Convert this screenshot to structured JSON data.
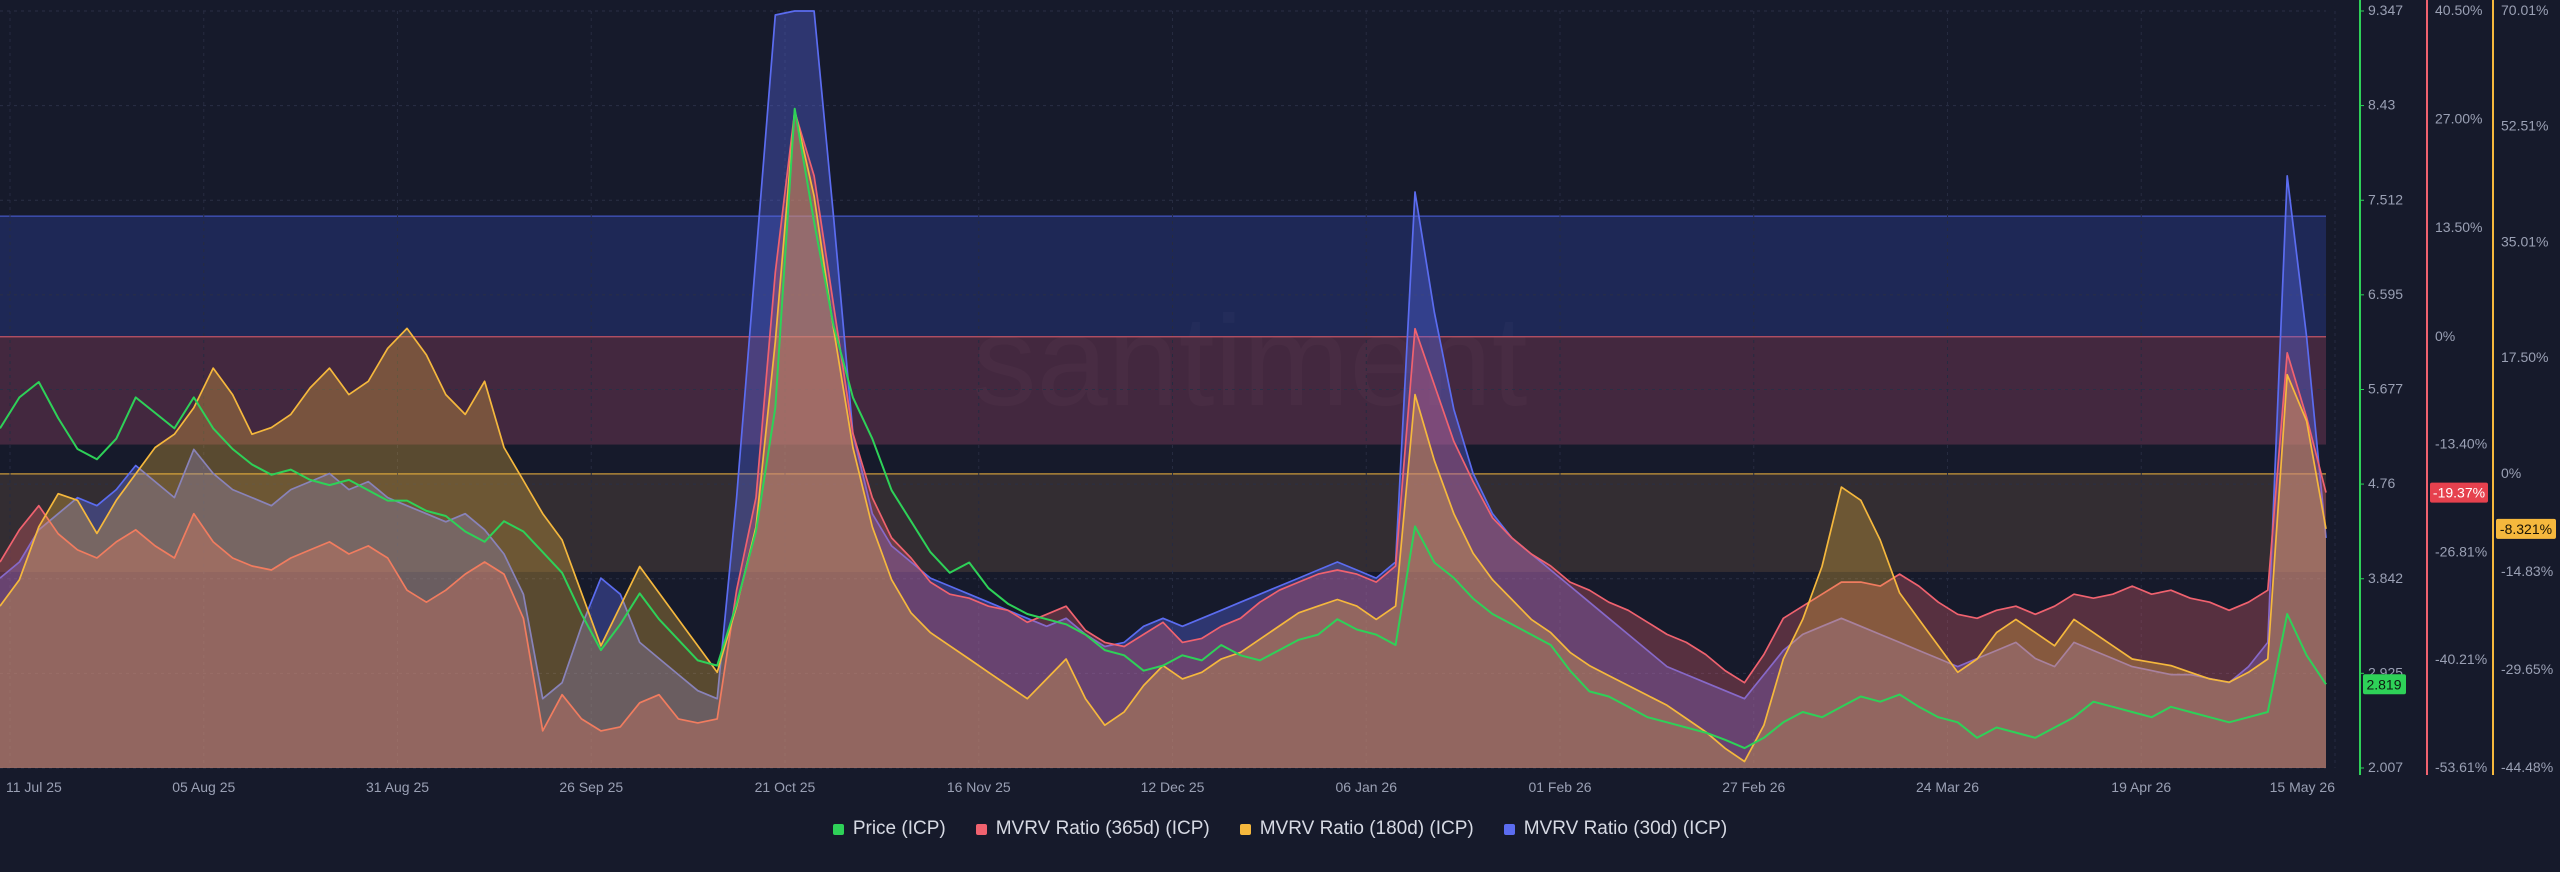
{
  "colors": {
    "background": "#161a2b",
    "price": "#2ed158",
    "mvrv365": "#f0626f",
    "mvrv180": "#f5b83d",
    "mvrv30": "#5b6cf0",
    "price_tag_bg": "#2ed158",
    "mvrv365_tag_bg": "#e6414e",
    "mvrv180_tag_bg": "#f5b83d"
  },
  "watermark": "santiment",
  "chart_data": {
    "type": "line",
    "x_tick_labels": [
      "11 Jul 25",
      "05 Aug 25",
      "31 Aug 25",
      "26 Sep 25",
      "21 Oct 25",
      "16 Nov 25",
      "12 Dec 25",
      "06 Jan 26",
      "01 Feb 26",
      "27 Feb 26",
      "24 Mar 26",
      "19 Apr 26",
      "15 May 26"
    ],
    "x_range": [
      "2025-07-11",
      "2026-05-15"
    ],
    "axes": {
      "price": {
        "ticks": [
          "9.347",
          "8.43",
          "7.512",
          "6.595",
          "5.677",
          "4.76",
          "3.842",
          "2.925",
          "2.007"
        ],
        "range": [
          2.007,
          9.347
        ],
        "current_value": "2.819"
      },
      "mvrv365": {
        "ticks": [
          "40.50%",
          "27.00%",
          "13.50%",
          "0%",
          "-13.40%",
          "-26.81%",
          "-40.21%",
          "-53.61%"
        ],
        "range": [
          -53.61,
          40.5
        ],
        "current_value": "-19.37%"
      },
      "mvrv180": {
        "ticks": [
          "70.01%",
          "52.51%",
          "35.01%",
          "17.50%",
          "0%",
          "-14.83%",
          "-29.65%",
          "-44.48%"
        ],
        "range": [
          -44.48,
          70.01
        ],
        "current_value": "-8.321%"
      }
    },
    "bands": [
      {
        "series": "MVRV Ratio (30d) (ICP)",
        "from": 0,
        "to": 15
      },
      {
        "series": "MVRV Ratio (365d) (ICP)",
        "from": -13.4,
        "to": 0
      },
      {
        "series": "MVRV Ratio (180d) (ICP)",
        "from": -14.83,
        "to": 0
      }
    ],
    "series": [
      {
        "name": "Price (ICP)",
        "key": "price",
        "axis": "price",
        "values": [
          5.3,
          5.6,
          5.75,
          5.4,
          5.1,
          5.0,
          5.2,
          5.6,
          5.45,
          5.3,
          5.6,
          5.3,
          5.1,
          4.95,
          4.85,
          4.9,
          4.8,
          4.75,
          4.8,
          4.7,
          4.6,
          4.6,
          4.5,
          4.45,
          4.3,
          4.2,
          4.4,
          4.3,
          4.1,
          3.9,
          3.5,
          3.15,
          3.4,
          3.7,
          3.45,
          3.25,
          3.05,
          3.0,
          3.6,
          4.3,
          5.5,
          8.4,
          7.3,
          6.3,
          5.6,
          5.2,
          4.7,
          4.4,
          4.1,
          3.9,
          4.0,
          3.75,
          3.6,
          3.5,
          3.45,
          3.4,
          3.3,
          3.15,
          3.1,
          2.95,
          3.0,
          3.1,
          3.05,
          3.2,
          3.1,
          3.05,
          3.15,
          3.25,
          3.3,
          3.45,
          3.35,
          3.3,
          3.2,
          4.35,
          4.0,
          3.85,
          3.65,
          3.5,
          3.4,
          3.3,
          3.2,
          2.95,
          2.75,
          2.7,
          2.6,
          2.5,
          2.45,
          2.4,
          2.35,
          2.28,
          2.2,
          2.3,
          2.45,
          2.55,
          2.5,
          2.6,
          2.7,
          2.65,
          2.72,
          2.6,
          2.5,
          2.45,
          2.3,
          2.4,
          2.35,
          2.3,
          2.4,
          2.5,
          2.65,
          2.6,
          2.55,
          2.5,
          2.6,
          2.55,
          2.5,
          2.45,
          2.5,
          2.55,
          3.5,
          3.1,
          2.819
        ]
      },
      {
        "name": "MVRV Ratio (365d) (ICP)",
        "key": "mvrv365",
        "axis": "mvrv365",
        "values": [
          -28.0,
          -24.0,
          -21.0,
          -24.5,
          -26.5,
          -27.5,
          -25.5,
          -24.0,
          -26.0,
          -27.5,
          -22.0,
          -25.5,
          -27.5,
          -28.5,
          -29.0,
          -27.5,
          -26.5,
          -25.5,
          -27.0,
          -26.0,
          -27.5,
          -31.5,
          -33.0,
          -31.5,
          -29.5,
          -28.0,
          -29.5,
          -35.0,
          -49.0,
          -44.5,
          -47.5,
          -49.0,
          -48.5,
          -45.5,
          -44.5,
          -47.5,
          -48.0,
          -47.5,
          -31.5,
          -20.0,
          8.0,
          28.0,
          20.0,
          4.0,
          -12.0,
          -20.0,
          -25.0,
          -27.5,
          -30.5,
          -32.0,
          -32.5,
          -33.5,
          -34.0,
          -35.5,
          -34.5,
          -33.5,
          -36.5,
          -38.0,
          -38.5,
          -37.0,
          -35.5,
          -38.0,
          -37.5,
          -36.0,
          -35.0,
          -33.0,
          -31.5,
          -30.5,
          -29.5,
          -29.0,
          -29.5,
          -30.5,
          -28.5,
          1.0,
          -6.0,
          -13.0,
          -18.0,
          -22.5,
          -25.0,
          -27.0,
          -28.5,
          -30.5,
          -31.5,
          -33.0,
          -34.0,
          -35.5,
          -37.0,
          -38.0,
          -39.5,
          -41.5,
          -43.0,
          -39.5,
          -35.0,
          -33.5,
          -32.0,
          -30.5,
          -30.5,
          -31.0,
          -29.5,
          -31.0,
          -33.0,
          -34.5,
          -35.0,
          -34.0,
          -33.5,
          -34.5,
          -33.5,
          -32.0,
          -32.5,
          -32.0,
          -31.0,
          -32.0,
          -31.5,
          -32.5,
          -33.0,
          -34.0,
          -33.0,
          -31.5,
          -2.0,
          -10.0,
          -19.37
        ]
      },
      {
        "name": "MVRV Ratio (180d) (ICP)",
        "key": "mvrv180",
        "axis": "mvrv180",
        "values": [
          -20.0,
          -16.0,
          -8.0,
          -3.0,
          -4.0,
          -9.0,
          -4.0,
          0.0,
          4.0,
          6.0,
          10.0,
          16.0,
          12.0,
          6.0,
          7.0,
          9.0,
          13.0,
          16.0,
          12.0,
          14.0,
          19.0,
          22.0,
          18.0,
          12.0,
          9.0,
          14.0,
          4.0,
          -1.0,
          -6.0,
          -10.0,
          -18.0,
          -26.0,
          -20.0,
          -14.0,
          -18.0,
          -22.0,
          -26.0,
          -30.0,
          -20.0,
          -8.0,
          20.0,
          55.0,
          42.0,
          22.0,
          4.0,
          -8.0,
          -16.0,
          -21.0,
          -24.0,
          -26.0,
          -28.0,
          -30.0,
          -32.0,
          -34.0,
          -31.0,
          -28.0,
          -34.0,
          -38.0,
          -36.0,
          -32.0,
          -29.0,
          -31.0,
          -30.0,
          -28.0,
          -27.0,
          -25.0,
          -23.0,
          -21.0,
          -20.0,
          -19.0,
          -20.0,
          -22.0,
          -20.0,
          12.0,
          2.0,
          -6.0,
          -12.0,
          -16.0,
          -19.0,
          -22.0,
          -24.0,
          -27.0,
          -29.0,
          -30.5,
          -32.0,
          -33.5,
          -35.0,
          -37.0,
          -39.0,
          -41.5,
          -43.5,
          -38.0,
          -28.0,
          -22.0,
          -14.0,
          -2.0,
          -4.0,
          -10.0,
          -18.0,
          -22.0,
          -26.0,
          -30.0,
          -28.0,
          -24.0,
          -22.0,
          -24.0,
          -26.0,
          -22.0,
          -24.0,
          -26.0,
          -28.0,
          -28.5,
          -29.0,
          -30.0,
          -31.0,
          -31.5,
          -30.0,
          -28.0,
          15.0,
          8.0,
          -8.321
        ]
      },
      {
        "name": "MVRV Ratio (30d) (ICP)",
        "key": "mvrv30",
        "axis": "mvrv30",
        "values": [
          -30.0,
          -28.0,
          -24.0,
          -22.0,
          -20.0,
          -21.0,
          -19.0,
          -16.0,
          -18.0,
          -20.0,
          -14.0,
          -17.0,
          -19.0,
          -20.0,
          -21.0,
          -19.0,
          -18.0,
          -17.0,
          -19.0,
          -18.0,
          -20.0,
          -21.0,
          -22.0,
          -23.0,
          -22.0,
          -24.0,
          -27.0,
          -32.0,
          -45.0,
          -43.0,
          -36.0,
          -30.0,
          -32.0,
          -38.0,
          -40.0,
          -42.0,
          -44.0,
          -45.0,
          -20.0,
          10.0,
          40.0,
          92.0,
          55.0,
          15.0,
          -12.0,
          -22.0,
          -26.0,
          -28.0,
          -30.0,
          -31.0,
          -32.0,
          -33.0,
          -34.0,
          -35.0,
          -36.0,
          -35.0,
          -37.0,
          -38.5,
          -38.0,
          -36.0,
          -35.0,
          -36.0,
          -35.0,
          -34.0,
          -33.0,
          -32.0,
          -31.0,
          -30.0,
          -29.0,
          -28.0,
          -29.0,
          -30.0,
          -28.0,
          18.0,
          3.0,
          -9.0,
          -17.0,
          -22.0,
          -25.0,
          -27.0,
          -29.0,
          -31.0,
          -33.0,
          -35.0,
          -37.0,
          -39.0,
          -41.0,
          -42.0,
          -43.0,
          -44.0,
          -45.0,
          -42.0,
          -39.0,
          -37.0,
          -36.0,
          -35.0,
          -36.0,
          -37.0,
          -38.0,
          -39.0,
          -40.0,
          -41.0,
          -40.0,
          -39.0,
          -38.0,
          -40.0,
          -41.0,
          -38.0,
          -39.0,
          -40.0,
          -41.0,
          -41.5,
          -42.0,
          -42.0,
          -42.5,
          -43.0,
          -41.0,
          -38.0,
          20.0,
          0.0,
          -25.0
        ]
      }
    ]
  },
  "legend": [
    {
      "label": "Price (ICP)",
      "key": "price"
    },
    {
      "label": "MVRV Ratio (365d) (ICP)",
      "key": "mvrv365"
    },
    {
      "label": "MVRV Ratio (180d) (ICP)",
      "key": "mvrv180"
    },
    {
      "label": "MVRV Ratio (30d) (ICP)",
      "key": "mvrv30"
    }
  ]
}
